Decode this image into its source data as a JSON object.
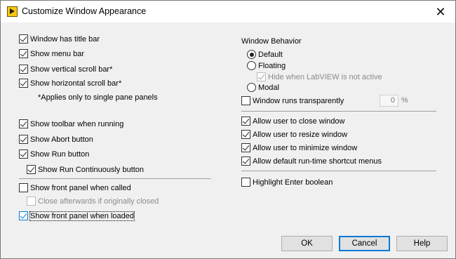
{
  "window": {
    "title": "Customize Window Appearance",
    "close_glyph": "✕"
  },
  "left": {
    "title_bar": {
      "label": "Window has title bar",
      "checked": true
    },
    "menu_bar": {
      "label": "Show menu bar",
      "checked": true
    },
    "vscroll": {
      "label": "Show vertical scroll bar*",
      "checked": true
    },
    "hscroll": {
      "label": "Show horizontal scroll bar*",
      "checked": true
    },
    "note": "*Applies only to single pane panels",
    "toolbar": {
      "label": "Show toolbar when running",
      "checked": true
    },
    "abort": {
      "label": "Show Abort button",
      "checked": true
    },
    "run": {
      "label": "Show Run button",
      "checked": true
    },
    "run_cont": {
      "label": "Show Run Continuously button",
      "checked": true
    },
    "fp_called": {
      "label": "Show front panel when called",
      "checked": false
    },
    "close_after": {
      "label": "Close afterwards if originally closed",
      "checked": false,
      "disabled": true
    },
    "fp_loaded": {
      "label": "Show front panel when loaded",
      "checked": true,
      "focused": true
    }
  },
  "right": {
    "behavior_title": "Window Behavior",
    "radio_default": {
      "label": "Default",
      "selected": true
    },
    "radio_floating": {
      "label": "Floating",
      "selected": false
    },
    "hide_inactive": {
      "label": "Hide when LabVIEW is not active",
      "checked": true,
      "disabled": true
    },
    "radio_modal": {
      "label": "Modal",
      "selected": false
    },
    "transparent": {
      "label": "Window runs transparently",
      "checked": false
    },
    "transparency_value": "0",
    "transparency_unit": "%",
    "allow_close": {
      "label": "Allow user to close window",
      "checked": true
    },
    "allow_resize": {
      "label": "Allow user to resize window",
      "checked": true
    },
    "allow_minimize": {
      "label": "Allow user to minimize window",
      "checked": true
    },
    "allow_menus": {
      "label": "Allow default run-time shortcut menus",
      "checked": true
    },
    "highlight_enter": {
      "label": "Highlight Enter boolean",
      "checked": false
    }
  },
  "buttons": {
    "ok": "OK",
    "cancel": "Cancel",
    "help": "Help"
  },
  "colors": {
    "focus_accent": "#0078d7",
    "dialog_bg": "#f0f0f0"
  }
}
